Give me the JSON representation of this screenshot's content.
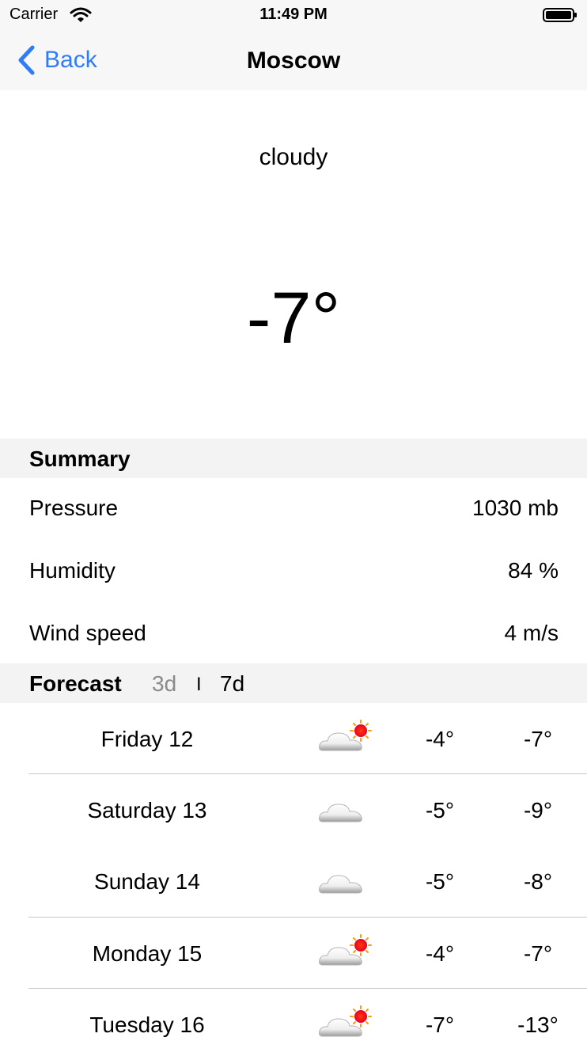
{
  "status_bar": {
    "carrier": "Carrier",
    "time": "11:49 PM"
  },
  "nav": {
    "back_label": "Back",
    "title": "Moscow"
  },
  "current": {
    "condition": "cloudy",
    "temperature": "-7°"
  },
  "summary": {
    "title": "Summary",
    "rows": [
      {
        "label": "Pressure",
        "value": "1030 mb"
      },
      {
        "label": "Humidity",
        "value": "84 %"
      },
      {
        "label": "Wind speed",
        "value": "4 m/s"
      }
    ]
  },
  "forecast": {
    "title": "Forecast",
    "segments": {
      "three_day": "3d",
      "divider": "I",
      "seven_day": "7d"
    },
    "days": [
      {
        "day": "Friday 12",
        "icon": "cloud-sun-icon",
        "hi": "-4°",
        "lo": "-7°"
      },
      {
        "day": "Saturday 13",
        "icon": "cloud-icon",
        "hi": "-5°",
        "lo": "-9°"
      },
      {
        "day": "Sunday 14",
        "icon": "cloud-icon",
        "hi": "-5°",
        "lo": "-8°"
      },
      {
        "day": "Monday 15",
        "icon": "cloud-sun-icon",
        "hi": "-4°",
        "lo": "-7°"
      },
      {
        "day": "Tuesday 16",
        "icon": "cloud-sun-icon",
        "hi": "-7°",
        "lo": "-13°"
      }
    ]
  },
  "colors": {
    "accent": "#2f7cf6",
    "header_bg": "#f3f3f3",
    "muted": "#8a8a8a"
  }
}
